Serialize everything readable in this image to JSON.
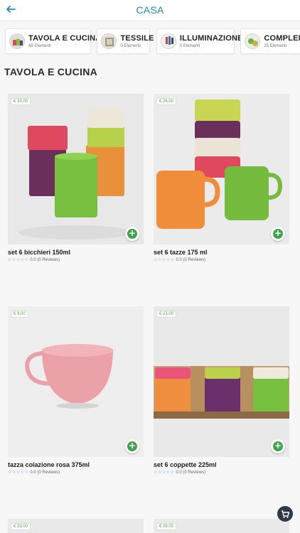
{
  "header": {
    "title": "CASA"
  },
  "categories": [
    {
      "name": "TAVOLA E CUCINA",
      "count": "48 Elementi"
    },
    {
      "name": "TESSILE",
      "count": "0 Elementi"
    },
    {
      "name": "ILLUMINAZIONE",
      "count": "0 Elementi"
    },
    {
      "name": "COMPLEMEN",
      "count": "25 Elementi"
    }
  ],
  "section": {
    "title": "TAVOLA E CUCINA"
  },
  "products": [
    {
      "price": "€ 33.00",
      "name": "set 6 bicchieri 150ml",
      "stars": "☆☆☆☆☆",
      "rating": "0.0 (0 Reviews)"
    },
    {
      "price": "€ 26.00",
      "name": "set 6 tazze 175 ml",
      "stars": "☆☆☆☆☆",
      "rating": "0.0 (0 Reviews)"
    },
    {
      "price": "€ 9.00",
      "name": "tazza colazione rosa 375ml",
      "stars": "☆☆☆☆☆",
      "rating": "0.0 (0 Reviews)"
    },
    {
      "price": "€ 23.00",
      "name": "set 6 coppette 225ml",
      "stars": "☆☆☆☆☆",
      "rating": "0.0 (0 Reviews)"
    },
    {
      "price": "€ 33.00"
    },
    {
      "price": "€ 39.00"
    }
  ],
  "colors": {
    "accent": "#1a8bd0",
    "add": "#3fa34d",
    "price": "#5aa63a"
  }
}
